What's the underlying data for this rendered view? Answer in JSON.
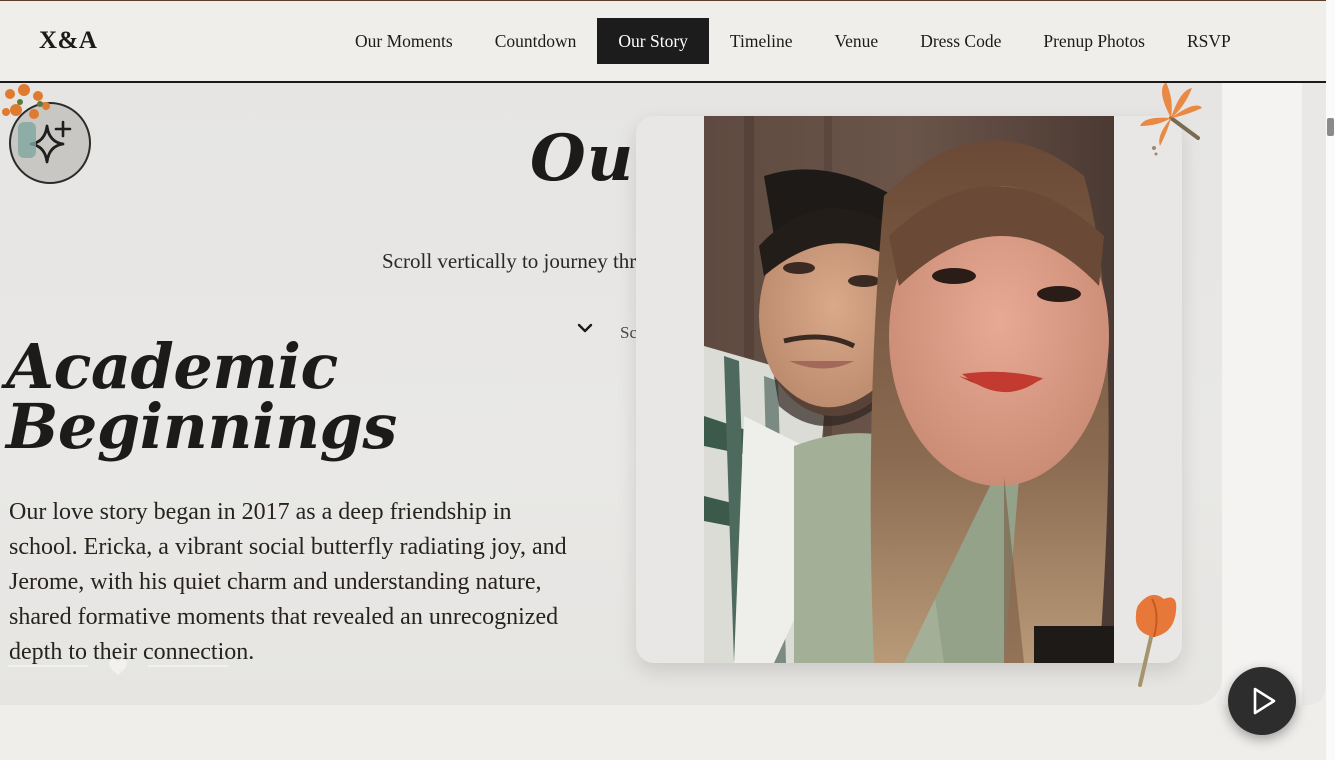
{
  "nav": {
    "brand": "X&A",
    "links": [
      {
        "label": "Our Moments"
      },
      {
        "label": "Countdown"
      },
      {
        "label": "Our Story"
      },
      {
        "label": "Timeline"
      },
      {
        "label": "Venue"
      },
      {
        "label": "Dress Code"
      },
      {
        "label": "Prenup Photos"
      },
      {
        "label": "RSVP"
      }
    ],
    "active_label": "Our Story"
  },
  "story": {
    "heading": "Our Story",
    "subtitle": "Scroll vertically to journey through our love story horizontally",
    "scroll_hint": "Scroll down"
  },
  "chapter": {
    "title_line1": "Academic",
    "title_line2": "Beginnings",
    "body": "Our love story began in 2017 as a deep friendship in school. Ericka, a vibrant social butterfly radiating joy, and Jerome, with his quiet charm and understanding nature, shared formative moments that revealed an unrecognized depth to their connection."
  },
  "icons": {
    "badge": "sparkle-icon",
    "play": "play-icon",
    "scroll_down": "chevron-down-icon",
    "scroll_next": "chevron-right-icon",
    "divider": "heart-icon"
  },
  "colors": {
    "accent_dark": "#1c1c1c",
    "background": "#efeeeb",
    "section": "#e6e5e3"
  }
}
